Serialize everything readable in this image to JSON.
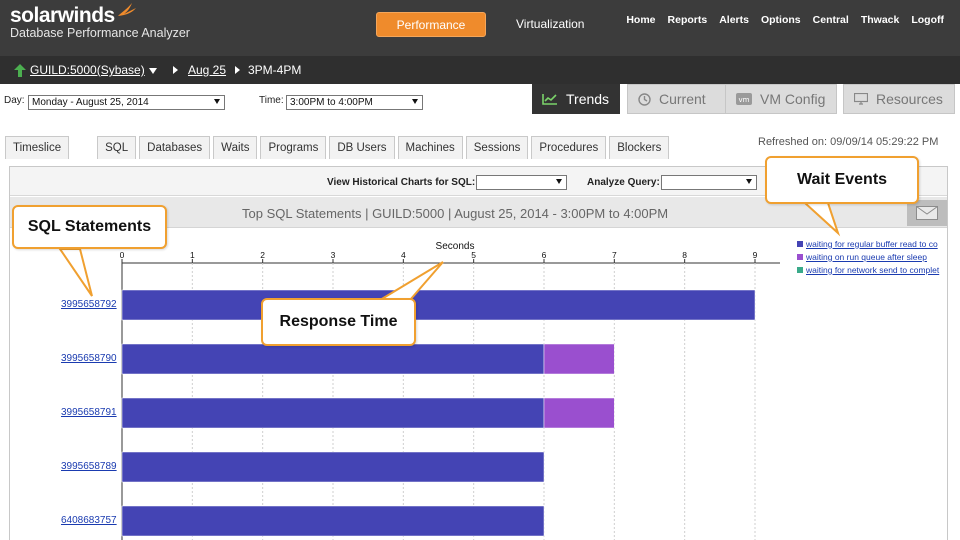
{
  "header": {
    "brand": "solarwinds",
    "product": "Database Performance Analyzer",
    "perf_button": "Performance",
    "virtualization": "Virtualization",
    "links": [
      "Home",
      "Reports",
      "Alerts",
      "Options",
      "Central",
      "Thwack",
      "Logoff"
    ]
  },
  "breadcrumb": {
    "instance": "GUILD:5000(Sybase)",
    "date": "Aug 25",
    "time": "3PM-4PM"
  },
  "filters": {
    "day_label": "Day:",
    "day_value": "Monday - August 25, 2014",
    "time_label": "Time:",
    "time_value": "3:00PM to 4:00PM"
  },
  "view_tabs": [
    {
      "label": "Trends",
      "icon": "trend-icon"
    },
    {
      "label": "Current",
      "icon": "clock-icon"
    },
    {
      "label": "VM Config",
      "icon": "vm-icon"
    },
    {
      "label": "Resources",
      "icon": "monitor-icon"
    }
  ],
  "sub_tabs": [
    "Timeslice",
    "SQL",
    "Databases",
    "Waits",
    "Programs",
    "DB Users",
    "Machines",
    "Sessions",
    "Procedures",
    "Blockers"
  ],
  "active_sub_tab": "SQL",
  "refreshed": "Refreshed on: 09/09/14 05:29:22 PM",
  "toolbar": {
    "historical_label": "View Historical Charts for SQL:",
    "historical_value": "",
    "analyze_label": "Analyze Query:",
    "analyze_value": ""
  },
  "chart_title": "Top SQL Statements | GUILD:5000 | August 25, 2014 - 3:00PM to 4:00PM",
  "legend": [
    {
      "label": "waiting for regular buffer read to co",
      "color": "#4444b4"
    },
    {
      "label": "waiting on run queue after sleep",
      "color": "#9a4fcf"
    },
    {
      "label": "waiting for network send to complet",
      "color": "#3aaa8a"
    }
  ],
  "callouts": {
    "sql": "SQL Statements",
    "wait": "Wait Events",
    "response": "Response Time"
  },
  "chart_data": {
    "type": "bar",
    "orientation": "horizontal",
    "stacked": true,
    "xlabel": "Seconds",
    "xlim": [
      0,
      9
    ],
    "xticks": [
      0,
      1,
      2,
      3,
      4,
      5,
      6,
      7,
      8,
      9
    ],
    "categories": [
      "3995658792",
      "3995658790",
      "3995658791",
      "3995658789",
      "6408683757"
    ],
    "series": [
      {
        "name": "waiting for regular buffer read to co",
        "color": "#4444b4",
        "values": [
          9,
          6,
          6,
          6,
          6
        ]
      },
      {
        "name": "waiting on run queue after sleep",
        "color": "#9a4fcf",
        "values": [
          0,
          1,
          1,
          0,
          0
        ]
      },
      {
        "name": "waiting for network send to complet",
        "color": "#3aaa8a",
        "values": [
          0,
          0,
          0,
          0,
          0
        ]
      }
    ],
    "grid": true
  }
}
